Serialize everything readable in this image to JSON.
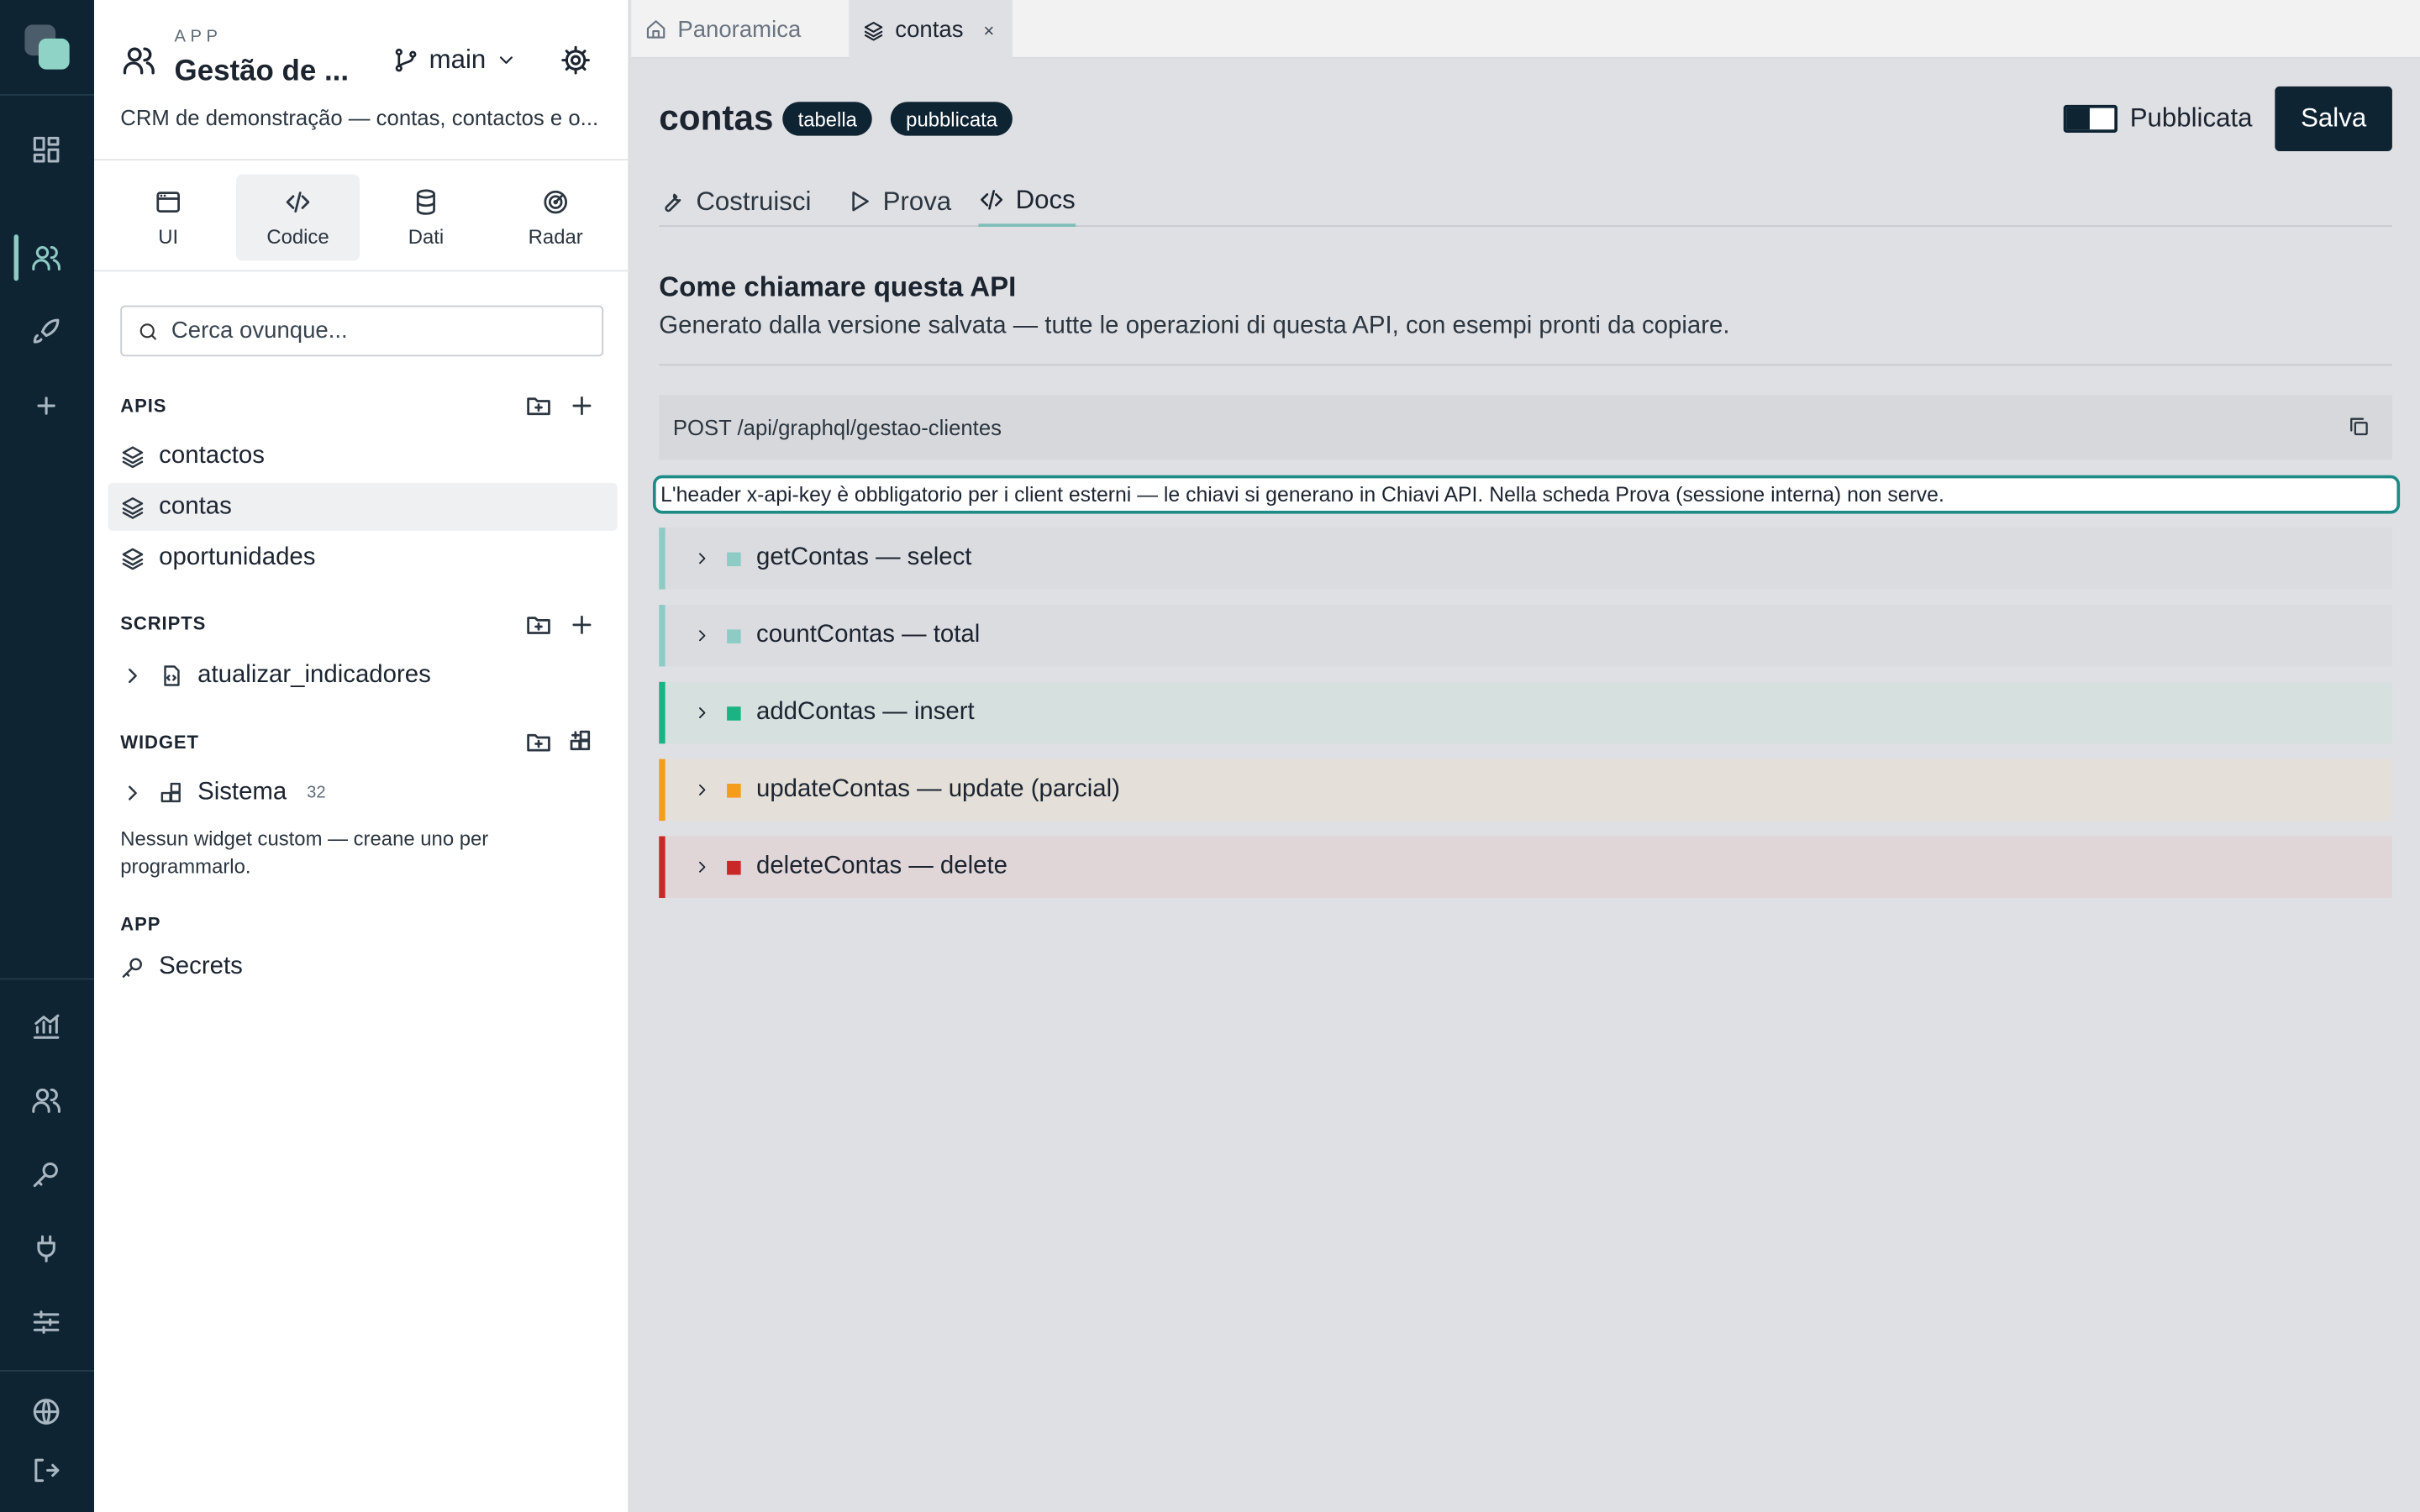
{
  "app": {
    "kicker": "APP",
    "name": "Gestão de ...",
    "branch": "main",
    "description": "CRM de demonstração — contas, contactos e o..."
  },
  "modes": [
    {
      "label": "UI",
      "icon": "window-icon"
    },
    {
      "label": "Codice",
      "icon": "code-icon"
    },
    {
      "label": "Dati",
      "icon": "database-icon"
    },
    {
      "label": "Radar",
      "icon": "radar-icon"
    }
  ],
  "search": {
    "placeholder": "Cerca ovunque..."
  },
  "sections": {
    "apis": {
      "title": "APIS",
      "items": [
        "contactos",
        "contas",
        "oportunidades"
      ]
    },
    "scripts": {
      "title": "SCRIPTS",
      "items": [
        "atualizar_indicadores"
      ]
    },
    "widget": {
      "title": "WIDGET",
      "items": [
        {
          "label": "Sistema",
          "count": "32"
        }
      ],
      "note": "Nessun widget custom — creane uno per programmarlo."
    },
    "app": {
      "title": "APP",
      "items": [
        "Secrets"
      ]
    }
  },
  "tabs": [
    {
      "label": "Panoramica"
    },
    {
      "label": "contas",
      "close": "×"
    }
  ],
  "page": {
    "title": "contas",
    "badges": [
      "tabella",
      "pubblicata"
    ],
    "toggle_label": "Pubblicata",
    "save_label": "Salva",
    "subtabs": [
      "Costruisci",
      "Prova",
      "Docs"
    ],
    "heading": "Come chiamare questa API",
    "lead": "Generato dalla versione salvata — tutte le operazioni di questa API, con esempi pronti da copiare.",
    "endpoint": "POST /api/graphql/gestao-clientes",
    "hint": "L'header x-api-key è obbligatorio per i client esterni — le chiavi si generano in Chiavi API. Nella scheda Prova (sessione interna) non serve."
  },
  "operations": [
    {
      "label": "getContas — select",
      "color": "#8ecbc5",
      "bg": "#dadcdf"
    },
    {
      "label": "countContas — total",
      "color": "#8ecbc5",
      "bg": "#dadcdf"
    },
    {
      "label": "addContas — insert",
      "color": "#19b384",
      "bg": "#d6e0df"
    },
    {
      "label": "updateContas — update (parcial)",
      "color": "#f59c1a",
      "bg": "#e4dfd8"
    },
    {
      "label": "deleteContas — delete",
      "color": "#c82828",
      "bg": "#e0d6d8"
    }
  ],
  "colors": {
    "brand": "#0f2433",
    "accent": "#1d8b86"
  }
}
